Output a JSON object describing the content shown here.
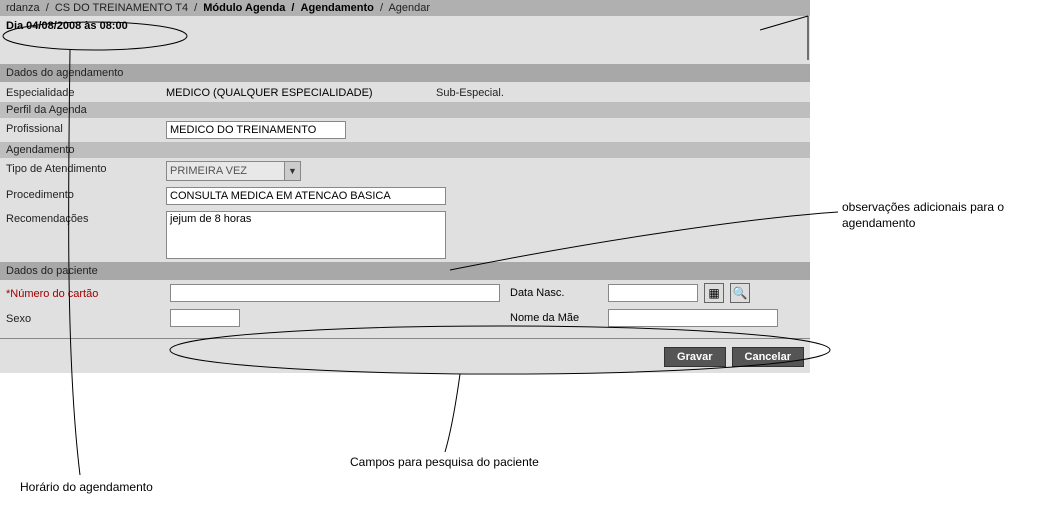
{
  "breadcrumb": {
    "p1": "rdanza",
    "p2": "CS DO TREINAMENTO T4",
    "p3": "Módulo Agenda",
    "p4": "Agendamento",
    "p5": "Agendar"
  },
  "datetime": "Dia 04/08/2008 às 08:00",
  "sections": {
    "dados_agendamento": "Dados do agendamento",
    "perfil_agenda": "Perfil da Agenda",
    "agendamento": "Agendamento",
    "dados_paciente": "Dados do paciente"
  },
  "fields": {
    "especialidade_label": "Especialidade",
    "especialidade_value": "MEDICO (QUALQUER ESPECIALIDADE)",
    "sub_especial_label": "Sub-Especial.",
    "profissional_label": "Profissional",
    "profissional_value": "MEDICO DO TREINAMENTO",
    "tipo_atendimento_label": "Tipo de Atendimento",
    "tipo_atendimento_value": "PRIMEIRA VEZ",
    "procedimento_label": "Procedimento",
    "procedimento_value": "CONSULTA MEDICA EM ATENCAO BASICA",
    "recomendacoes_label": "Recomendações",
    "recomendacoes_value": "jejum de 8 horas",
    "numero_cartao_label": "*Número do cartão",
    "data_nasc_label": "Data Nasc.",
    "sexo_label": "Sexo",
    "nome_mae_label": "Nome da Mãe"
  },
  "buttons": {
    "gravar": "Gravar",
    "cancelar": "Cancelar"
  },
  "annotations": {
    "obs": "observações adicionais para o agendamento",
    "campos": "Campos para pesquisa do paciente",
    "horario": "Horário do agendamento"
  },
  "icons": {
    "calendar": "▦",
    "search": "🔍",
    "dropdown": "▼"
  }
}
